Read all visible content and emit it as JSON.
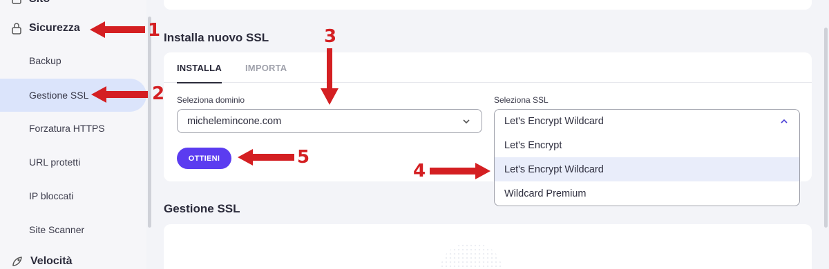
{
  "sidebar": {
    "site_label": "Sito",
    "security_label": "Sicurezza",
    "items": [
      {
        "label": "Backup"
      },
      {
        "label": "Gestione SSL"
      },
      {
        "label": "Forzatura HTTPS"
      },
      {
        "label": "URL protetti"
      },
      {
        "label": "IP bloccati"
      },
      {
        "label": "Site Scanner"
      }
    ],
    "speed_label": "Velocità"
  },
  "install_section": {
    "title": "Installa nuovo SSL",
    "tabs": [
      {
        "label": "INSTALLA",
        "active": true
      },
      {
        "label": "IMPORTA",
        "active": false
      }
    ],
    "domain_label": "Seleziona dominio",
    "domain_value": "michelemincone.com",
    "ssl_label": "Seleziona SSL",
    "ssl_value": "Let's Encrypt Wildcard",
    "ssl_options": [
      "Let's Encrypt",
      "Let's Encrypt Wildcard",
      "Wildcard Premium"
    ],
    "highlighted_option": "Let's Encrypt Wildcard",
    "submit_label": "OTTIENI"
  },
  "manage_section": {
    "title": "Gestione SSL"
  },
  "annotations": [
    "1",
    "2",
    "3",
    "4",
    "5"
  ],
  "colors": {
    "accent": "#5b3cf0",
    "active_item_bg": "#dbe4fb",
    "annotation_red": "#d41f22",
    "highlight_option_bg": "#e9edfa"
  },
  "icons": [
    "gear-icon",
    "lock-icon",
    "rocket-icon",
    "chevron-down-icon",
    "chevron-up-icon"
  ]
}
